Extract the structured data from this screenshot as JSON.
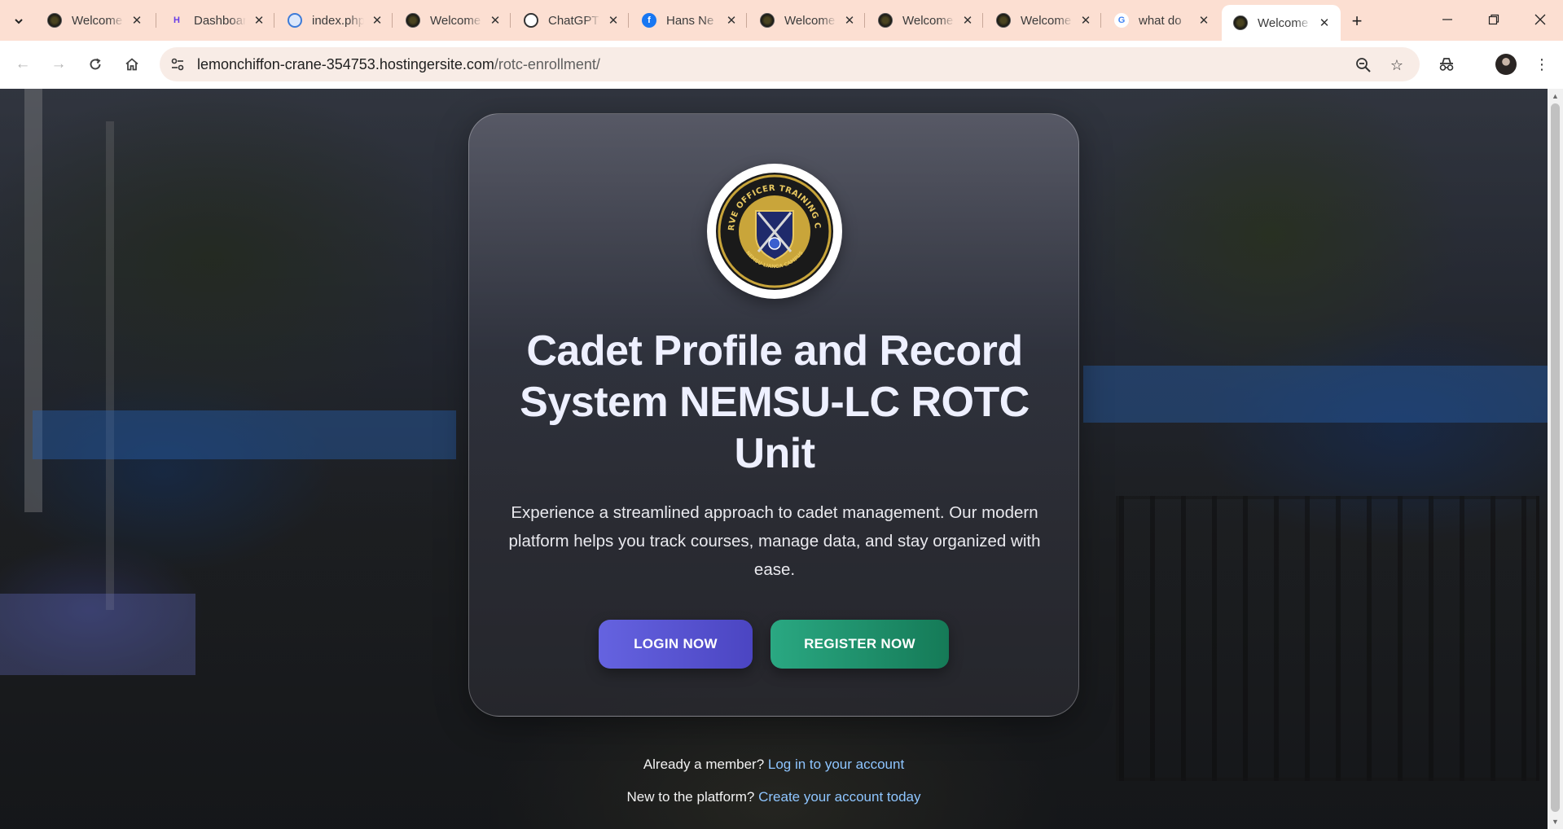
{
  "browser": {
    "tabs": [
      {
        "title": "Welcome",
        "favicon": "rotc-seal-icon"
      },
      {
        "title": "Dashboard",
        "favicon": "hostinger-icon"
      },
      {
        "title": "index.php",
        "favicon": "file-icon"
      },
      {
        "title": "Welcome",
        "favicon": "rotc-seal-icon"
      },
      {
        "title": "ChatGPT",
        "favicon": "openai-icon"
      },
      {
        "title": "Hans Ne",
        "favicon": "facebook-icon"
      },
      {
        "title": "Welcome",
        "favicon": "rotc-seal-icon"
      },
      {
        "title": "Welcome",
        "favicon": "rotc-seal-icon"
      },
      {
        "title": "Welcome",
        "favicon": "rotc-seal-icon"
      },
      {
        "title": "what do",
        "favicon": "google-icon"
      },
      {
        "title": "Welcome",
        "favicon": "rotc-seal-icon",
        "active": true
      }
    ],
    "url": {
      "domain": "lemonchiffon-crane-354753.hostingersite.com",
      "path": "/rotc-enrollment/"
    }
  },
  "hero": {
    "title": "Cadet Profile and Record System NEMSU-LC ROTC Unit",
    "description": "Experience a streamlined approach to cadet management. Our modern platform helps you track courses, manage data, and stay organized with ease.",
    "login_button": "LOGIN NOW",
    "register_button": "REGISTER NOW",
    "logo_text": {
      "ring": "RESERVE OFFICER TRAINING CORPS",
      "bottom": "NEMSU-LIANGA CAMPUS"
    }
  },
  "footer": {
    "member_prompt": "Already a member?",
    "member_link": "Log in to your account",
    "new_prompt": "New to the platform?",
    "new_link": "Create your account today"
  },
  "colors": {
    "login_button": "#5652d4",
    "register_button": "#1f9570",
    "link": "#8ec5ff",
    "tabstrip": "#fcdfd2"
  }
}
